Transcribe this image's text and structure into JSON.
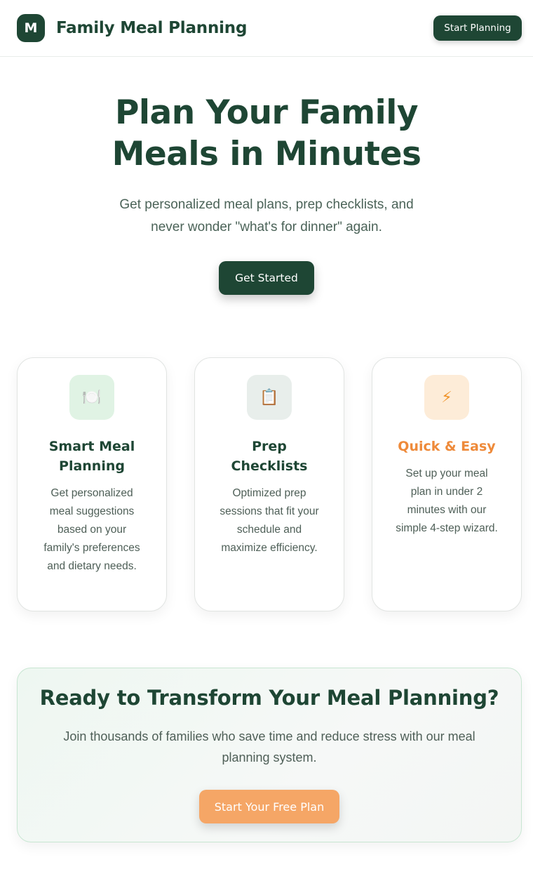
{
  "header": {
    "logo_letter": "M",
    "brand_name": "Family Meal Planning",
    "cta_label": "Start Planning"
  },
  "hero": {
    "title": "Plan Your Family Meals in Minutes",
    "subtitle": "Get personalized meal plans, prep checklists, and never wonder \"what's for dinner\" again.",
    "button_label": "Get Started"
  },
  "features": [
    {
      "icon": "🍽️",
      "icon_name": "plate-utensils-icon",
      "title": "Smart Meal Planning",
      "description": "Get personalized meal suggestions based on your family's preferences and dietary needs."
    },
    {
      "icon": "📋",
      "icon_name": "clipboard-icon",
      "title": "Prep Checklists",
      "description": "Optimized prep sessions that fit your schedule and maximize efficiency."
    },
    {
      "icon": "⚡",
      "icon_name": "lightning-icon",
      "title": "Quick & Easy",
      "description": "Set up your meal plan in under 2 minutes with our simple 4-step wizard."
    }
  ],
  "cta": {
    "title": "Ready to Transform Your Meal Planning?",
    "subtitle": "Join thousands of families who save time and reduce stress with our meal planning system.",
    "button_label": "Start Your Free Plan"
  },
  "colors": {
    "primary": "#1e4634",
    "accent_orange": "#f5a666",
    "feature_orange_title": "#ee8a3a"
  }
}
